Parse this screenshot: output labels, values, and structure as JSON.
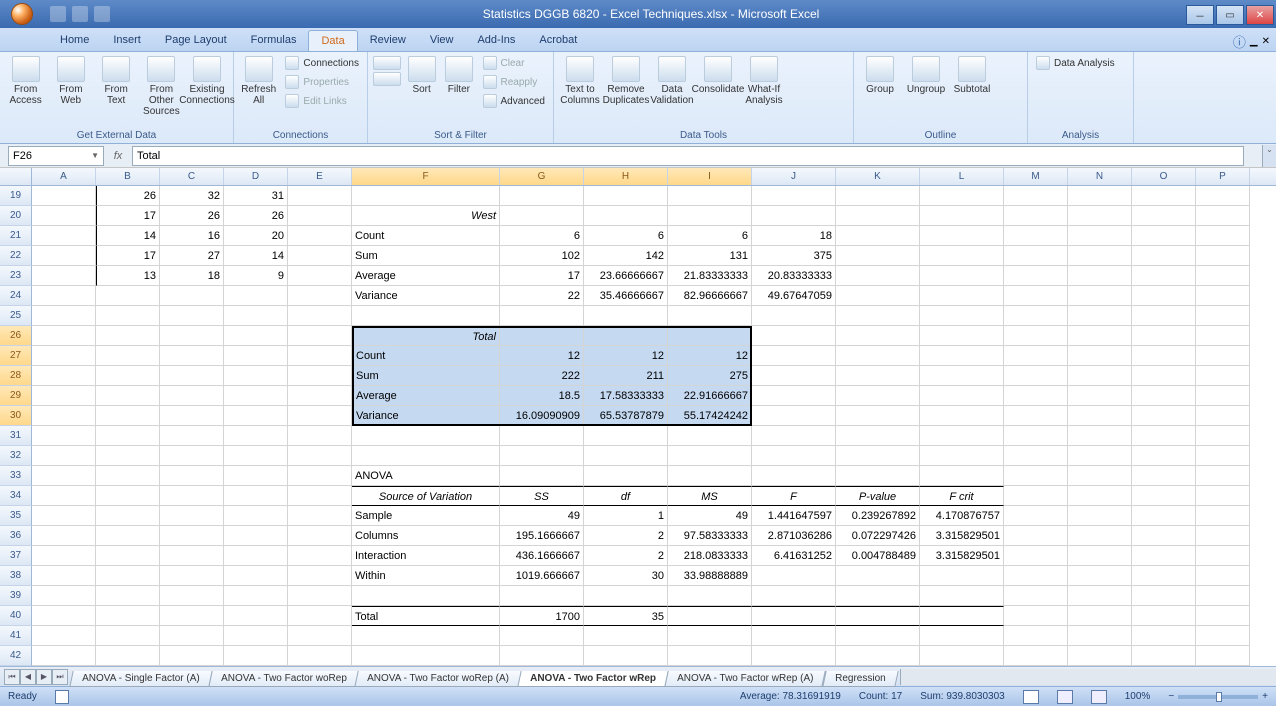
{
  "title": "Statistics DGGB 6820 - Excel Techniques.xlsx - Microsoft Excel",
  "tabs": [
    "Home",
    "Insert",
    "Page Layout",
    "Formulas",
    "Data",
    "Review",
    "View",
    "Add-Ins",
    "Acrobat"
  ],
  "active_tab": "Data",
  "ribbon": {
    "get_external": {
      "label": "Get External Data",
      "btns": [
        "From Access",
        "From Web",
        "From Text",
        "From Other Sources",
        "Existing Connections"
      ]
    },
    "connections": {
      "label": "Connections",
      "refresh": "Refresh All",
      "items": [
        "Connections",
        "Properties",
        "Edit Links"
      ]
    },
    "sort_filter": {
      "label": "Sort & Filter",
      "sort": "Sort",
      "filter": "Filter",
      "items": [
        "Clear",
        "Reapply",
        "Advanced"
      ]
    },
    "data_tools": {
      "label": "Data Tools",
      "btns": [
        "Text to Columns",
        "Remove Duplicates",
        "Data Validation",
        "Consolidate",
        "What-If Analysis"
      ]
    },
    "outline": {
      "label": "Outline",
      "btns": [
        "Group",
        "Ungroup",
        "Subtotal"
      ]
    },
    "analysis": {
      "label": "Analysis",
      "btn": "Data Analysis"
    }
  },
  "name_box": "F26",
  "formula": "Total",
  "columns": [
    "A",
    "B",
    "C",
    "D",
    "E",
    "F",
    "G",
    "H",
    "I",
    "J",
    "K",
    "L",
    "M",
    "N",
    "O",
    "P"
  ],
  "sel_cols": [
    "F",
    "G",
    "H",
    "I"
  ],
  "rows_top": [
    {
      "n": 19,
      "B": "26",
      "C": "32",
      "D": "31"
    },
    {
      "n": 20,
      "B": "17",
      "C": "26",
      "D": "26",
      "F": "West",
      "Fi": true,
      "Fr": true
    },
    {
      "n": 21,
      "B": "14",
      "C": "16",
      "D": "20",
      "F": "Count",
      "G": "6",
      "H": "6",
      "I": "6",
      "J": "18"
    },
    {
      "n": 22,
      "B": "17",
      "C": "27",
      "D": "14",
      "F": "Sum",
      "G": "102",
      "H": "142",
      "I": "131",
      "J": "375"
    },
    {
      "n": 23,
      "B": "13",
      "C": "18",
      "D": "9",
      "F": "Average",
      "G": "17",
      "H": "23.66666667",
      "I": "21.83333333",
      "J": "20.83333333"
    },
    {
      "n": 24,
      "F": "Variance",
      "G": "22",
      "H": "35.46666667",
      "I": "82.96666667",
      "J": "49.67647059"
    },
    {
      "n": 25
    }
  ],
  "total_block": {
    "header": "Total",
    "rows": [
      {
        "n": 27,
        "F": "Count",
        "G": "12",
        "H": "12",
        "I": "12"
      },
      {
        "n": 28,
        "F": "Sum",
        "G": "222",
        "H": "211",
        "I": "275"
      },
      {
        "n": 29,
        "F": "Average",
        "G": "18.5",
        "H": "17.58333333",
        "I": "22.91666667"
      },
      {
        "n": 30,
        "F": "Variance",
        "G": "16.09090909",
        "H": "65.53787879",
        "I": "55.17424242"
      }
    ]
  },
  "anova": {
    "title": "ANOVA",
    "header": {
      "F": "Source of Variation",
      "G": "SS",
      "H": "df",
      "I": "MS",
      "J": "F",
      "K": "P-value",
      "L": "F crit"
    },
    "rows": [
      {
        "n": 35,
        "F": "Sample",
        "G": "49",
        "H": "1",
        "I": "49",
        "J": "1.441647597",
        "K": "0.239267892",
        "L": "4.170876757"
      },
      {
        "n": 36,
        "F": "Columns",
        "G": "195.1666667",
        "H": "2",
        "I": "97.58333333",
        "J": "2.871036286",
        "K": "0.072297426",
        "L": "3.315829501"
      },
      {
        "n": 37,
        "F": "Interaction",
        "G": "436.1666667",
        "H": "2",
        "I": "218.0833333",
        "J": "6.41631252",
        "K": "0.004788489",
        "L": "3.315829501"
      },
      {
        "n": 38,
        "F": "Within",
        "G": "1019.666667",
        "H": "30",
        "I": "33.98888889"
      }
    ],
    "total": {
      "n": 40,
      "F": "Total",
      "G": "1700",
      "H": "35"
    }
  },
  "blank_rows": [
    31,
    32,
    39,
    41,
    42
  ],
  "sheet_tabs": [
    "ANOVA - Single Factor (A)",
    "ANOVA - Two Factor woRep",
    "ANOVA - Two Factor woRep (A)",
    "ANOVA - Two Factor wRep",
    "ANOVA - Two Factor wRep (A)",
    "Regression"
  ],
  "active_sheet": "ANOVA - Two Factor wRep",
  "status": {
    "ready": "Ready",
    "avg": "Average: 78.31691919",
    "count": "Count: 17",
    "sum": "Sum: 939.8030303",
    "zoom": "100%"
  },
  "chart_data": {
    "type": "table",
    "title": "ANOVA Two-Factor With Replication — Total block + ANOVA table",
    "total": {
      "Count": [
        12,
        12,
        12
      ],
      "Sum": [
        222,
        211,
        275
      ],
      "Average": [
        18.5,
        17.58333333,
        22.91666667
      ],
      "Variance": [
        16.09090909,
        65.53787879,
        55.17424242
      ]
    },
    "anova": [
      {
        "source": "Sample",
        "SS": 49,
        "df": 1,
        "MS": 49,
        "F": 1.441647597,
        "P": 0.239267892,
        "Fcrit": 4.170876757
      },
      {
        "source": "Columns",
        "SS": 195.1666667,
        "df": 2,
        "MS": 97.58333333,
        "F": 2.871036286,
        "P": 0.072297426,
        "Fcrit": 3.315829501
      },
      {
        "source": "Interaction",
        "SS": 436.1666667,
        "df": 2,
        "MS": 218.0833333,
        "F": 6.41631252,
        "P": 0.004788489,
        "Fcrit": 3.315829501
      },
      {
        "source": "Within",
        "SS": 1019.666667,
        "df": 30,
        "MS": 33.98888889
      },
      {
        "source": "Total",
        "SS": 1700,
        "df": 35
      }
    ]
  }
}
